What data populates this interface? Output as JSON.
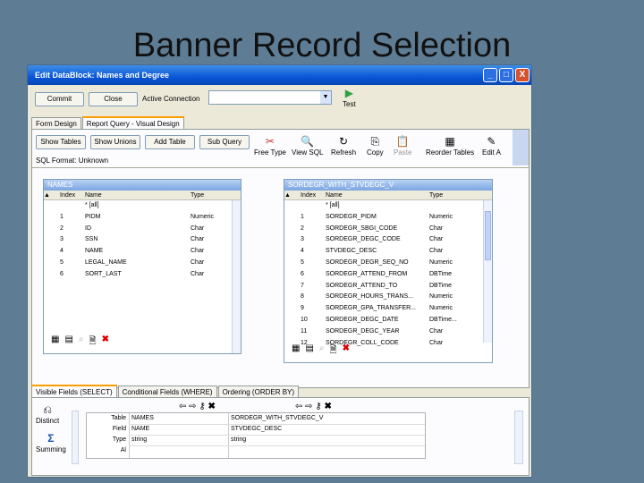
{
  "slide": {
    "title": "Banner Record Selection"
  },
  "window": {
    "title": "Edit DataBlock: Names and Degree",
    "controls": {
      "minimize": "_",
      "maximize": "□",
      "close": "X"
    }
  },
  "toolbar": {
    "commit_label": "Commit",
    "close_label": "Close",
    "active_connection_label": "Active Connection",
    "connection_value": "",
    "test_label": "Test"
  },
  "tabs": [
    "Form Design",
    "Report Query - Visual Design"
  ],
  "query_toolbar": {
    "show_tables": "Show Tables",
    "show_unions": "Show Unions",
    "add_table": "Add Table",
    "sub_query": "Sub Query",
    "sql_format": "SQL Format: Unknown",
    "icons": [
      {
        "label": "Free Type",
        "icon": "scissors-icon",
        "glyph": "✂"
      },
      {
        "label": "View SQL",
        "icon": "magnifier-icon",
        "glyph": "🔍"
      },
      {
        "label": "Refresh",
        "icon": "refresh-icon",
        "glyph": "↻"
      },
      {
        "label": "Copy",
        "icon": "copy-icon",
        "glyph": "⎘"
      },
      {
        "label": "Paste",
        "icon": "paste-icon",
        "glyph": "📋"
      },
      {
        "label": "Reorder Tables",
        "icon": "reorder-icon",
        "glyph": "▦"
      },
      {
        "label": "Edit A",
        "icon": "edit-icon",
        "glyph": "✎"
      }
    ]
  },
  "table_names": {
    "title": "NAMES",
    "columns": [
      "Index",
      "Name",
      "Type"
    ],
    "rows": [
      [
        "",
        "* [all]",
        ""
      ],
      [
        "1",
        "PIDM",
        "Numeric"
      ],
      [
        "2",
        "ID",
        "Char"
      ],
      [
        "3",
        "SSN",
        "Char"
      ],
      [
        "4",
        "NAME",
        "Char"
      ],
      [
        "5",
        "LEGAL_NAME",
        "Char"
      ],
      [
        "6",
        "SORT_LAST",
        "Char"
      ]
    ]
  },
  "table_degree": {
    "title": "SORDEGR_WITH_STVDEGC_V",
    "columns": [
      "Index",
      "Name",
      "Type"
    ],
    "rows": [
      [
        "",
        "* [all]",
        ""
      ],
      [
        "1",
        "SORDEGR_PIDM",
        "Numeric"
      ],
      [
        "2",
        "SORDEGR_SBGI_CODE",
        "Char"
      ],
      [
        "3",
        "SORDEGR_DEGC_CODE",
        "Char"
      ],
      [
        "4",
        "STVDEGC_DESC",
        "Char"
      ],
      [
        "5",
        "SORDEGR_DEGR_SEQ_NO",
        "Numeric"
      ],
      [
        "6",
        "SORDEGR_ATTEND_FROM",
        "DBTime"
      ],
      [
        "7",
        "SORDEGR_ATTEND_TO",
        "DBTime"
      ],
      [
        "8",
        "SORDEGR_HOURS_TRANS...",
        "Numeric"
      ],
      [
        "9",
        "SORDEGR_GPA_TRANSFER...",
        "Numeric"
      ],
      [
        "10",
        "SORDEGR_DEGC_DATE",
        "DBTime..."
      ],
      [
        "11",
        "SORDEGR_DEGC_YEAR",
        "Char"
      ],
      [
        "12",
        "SORDEGR_COLL_CODE",
        "Char"
      ]
    ]
  },
  "bottom_tabs": [
    "Visible Fields (SELECT)",
    "Conditional Fields (WHERE)",
    "Ordering (ORDER BY)"
  ],
  "fields_grid": {
    "row_labels": [
      "Table",
      "Field",
      "Type",
      "Al"
    ],
    "col1": [
      "NAMES",
      "NAME",
      "string",
      ""
    ],
    "col2": [
      "SORDEGR_WITH_STVDEGC_V",
      "STVDEGC_DESC",
      "string",
      ""
    ]
  },
  "side_buttons": {
    "distinct": "Distinct",
    "summing": "Summing",
    "summing_glyph": "Σ"
  }
}
